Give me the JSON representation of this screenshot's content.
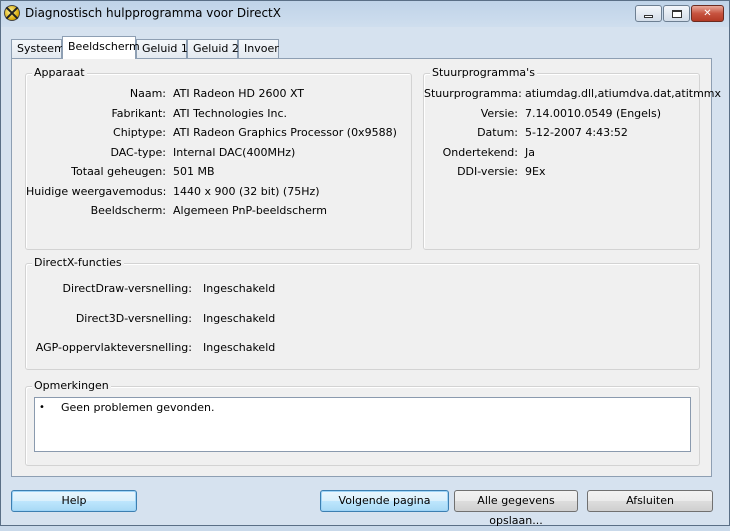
{
  "window": {
    "title": "Diagnostisch hulpprogramma voor DirectX"
  },
  "tabs": [
    "Systeem",
    "Beeldscherm",
    "Geluid 1",
    "Geluid 2",
    "Invoer"
  ],
  "active_tab": "Beeldscherm",
  "device": {
    "title": "Apparaat",
    "rows": [
      {
        "label": "Naam:",
        "value": "ATI Radeon HD 2600 XT"
      },
      {
        "label": "Fabrikant:",
        "value": "ATI Technologies Inc."
      },
      {
        "label": "Chiptype:",
        "value": "ATI Radeon Graphics Processor (0x9588)"
      },
      {
        "label": "DAC-type:",
        "value": "Internal DAC(400MHz)"
      },
      {
        "label": "Totaal geheugen:",
        "value": "501 MB"
      },
      {
        "label": "Huidige weergavemodus:",
        "value": "1440 x 900 (32 bit) (75Hz)"
      },
      {
        "label": "Beeldscherm:",
        "value": "Algemeen PnP-beeldscherm"
      }
    ]
  },
  "drivers": {
    "title": "Stuurprogramma's",
    "rows": [
      {
        "label": "Stuurprogramma:",
        "value": "atiumdag.dll,atiumdva.dat,atitmmx"
      },
      {
        "label": "Versie:",
        "value": "7.14.0010.0549 (Engels)"
      },
      {
        "label": "Datum:",
        "value": "5-12-2007 4:43:52"
      },
      {
        "label": "Ondertekend:",
        "value": "Ja"
      },
      {
        "label": "DDI-versie:",
        "value": "9Ex"
      }
    ]
  },
  "directx": {
    "title": "DirectX-functies",
    "rows": [
      {
        "label": "DirectDraw-versnelling:",
        "value": "Ingeschakeld"
      },
      {
        "label": "Direct3D-versnelling:",
        "value": "Ingeschakeld"
      },
      {
        "label": "AGP-oppervlakteversnelling:",
        "value": "Ingeschakeld"
      }
    ]
  },
  "notes": {
    "title": "Opmerkingen",
    "bullet": "•",
    "items": [
      "Geen problemen gevonden."
    ]
  },
  "buttons": {
    "help": "Help",
    "next": "Volgende pagina",
    "save_all": "Alle gegevens opslaan...",
    "close": "Afsluiten"
  },
  "titlebar_icons": {
    "close_glyph": "✕"
  }
}
